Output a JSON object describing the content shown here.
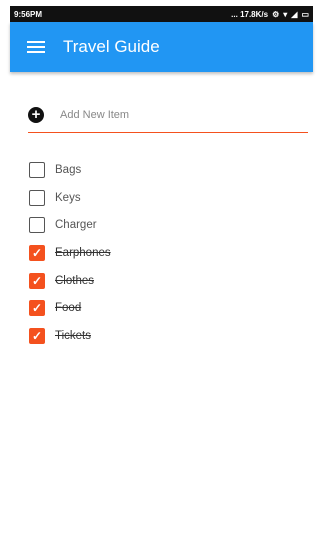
{
  "status": {
    "time": "9:56PM",
    "speed": "... 17.8K/s"
  },
  "appbar": {
    "title": "Travel Guide",
    "menu_icon": "hamburger-menu-icon"
  },
  "add_item": {
    "icon": "add-circle-icon",
    "placeholder": "Add New Item"
  },
  "accent_color": "#f4511e",
  "primary_color": "#2196f3",
  "items": [
    {
      "label": "Bags",
      "checked": false
    },
    {
      "label": "Keys",
      "checked": false
    },
    {
      "label": "Charger",
      "checked": false
    },
    {
      "label": "Earphones",
      "checked": true
    },
    {
      "label": "Clothes",
      "checked": true
    },
    {
      "label": "Food",
      "checked": true
    },
    {
      "label": "Tickets",
      "checked": true
    }
  ]
}
